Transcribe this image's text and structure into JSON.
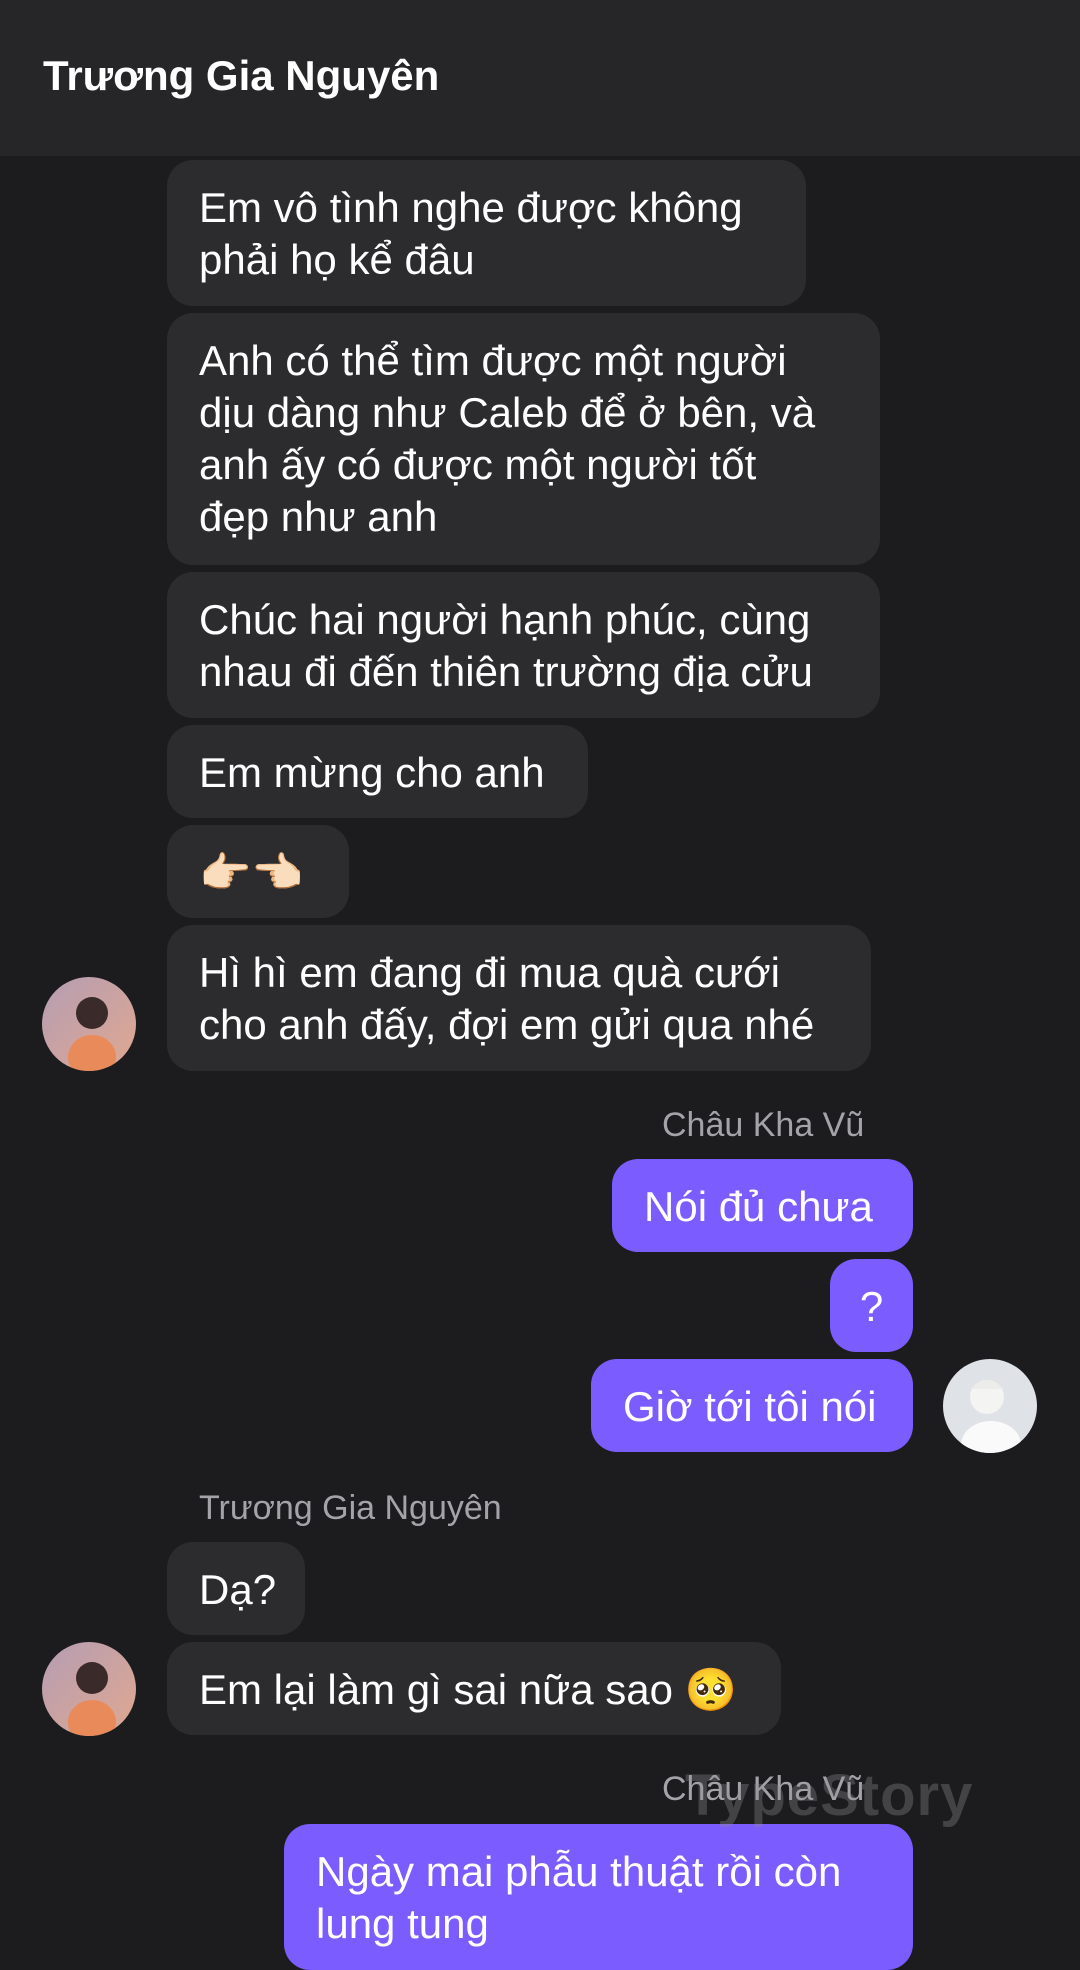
{
  "header": {
    "title": "Trương Gia Nguyên"
  },
  "messages": [
    {
      "side": "in",
      "text": "Em vô tình nghe được không\nphải họ kể đâu"
    },
    {
      "side": "in",
      "text": "Anh có thể tìm được một người\ndịu dàng như Caleb để ở bên, và\nanh ấy có được một người tốt\nđẹp như anh"
    },
    {
      "side": "in",
      "text": "Chúc hai người hạnh phúc, cùng\nnhau đi đến thiên trường địa cửu"
    },
    {
      "side": "in",
      "text": "Em mừng cho anh"
    },
    {
      "side": "in",
      "text": "👉🏻👈🏻"
    },
    {
      "side": "in",
      "text": "Hì hì em đang đi mua quà cưới\ncho anh đấy, đợi em gửi qua nhé"
    },
    {
      "side": "out",
      "text": "Nói đủ chưa"
    },
    {
      "side": "out",
      "text": "?"
    },
    {
      "side": "out",
      "text": "Giờ tới tôi nói"
    },
    {
      "side": "in",
      "text": "Dạ?"
    },
    {
      "side": "in",
      "text": "Em lại làm gì sai nữa sao 🥺"
    },
    {
      "side": "out",
      "text": "Ngày mai phẫu thuật rồi còn\nlung tung"
    }
  ],
  "names": {
    "out_1": "Châu Kha Vũ",
    "in_2": "Trương Gia Nguyên",
    "out_2": "Châu Kha Vũ"
  },
  "avatars": {
    "in": "avatar-truong-gia-nguyen",
    "out": "avatar-chau-kha-vu"
  },
  "watermark": "TypeStory",
  "colors": {
    "background": "#1c1c1e",
    "header": "#262628",
    "incoming_bubble": "#2c2c2e",
    "outgoing_bubble": "#7b5cff",
    "name_text": "#a3a3a8"
  }
}
